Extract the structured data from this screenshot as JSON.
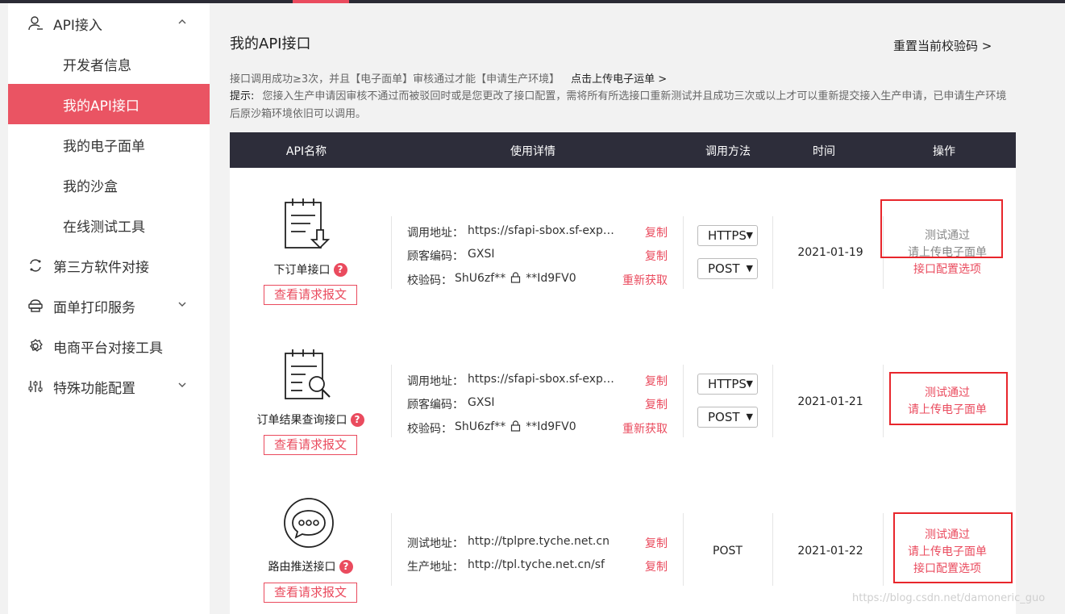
{
  "sidebar": {
    "items": [
      {
        "label": "API接入"
      },
      {
        "label": "开发者信息"
      },
      {
        "label": "我的API接口"
      },
      {
        "label": "我的电子面单"
      },
      {
        "label": "我的沙盒"
      },
      {
        "label": "在线测试工具"
      },
      {
        "label": "第三方软件对接"
      },
      {
        "label": "面单打印服务"
      },
      {
        "label": "电商平台对接工具"
      },
      {
        "label": "特殊功能配置"
      }
    ]
  },
  "main": {
    "title": "我的API接口",
    "reset_link": "重置当前校验码 >",
    "notice_line1": "接口调用成功≥3次，并且【电子面单】审核通过才能【申请生产环境】",
    "upload_link": "点击上传电子运单 >",
    "notice_label": "提示:",
    "notice_line2": "您接入生产申请因审核不通过而被驳回时或是您更改了接口配置，需将所有所选接口重新测试并且成功三次或以上才可以重新提交接入生产申请，已申请生产环境后原沙箱环境依旧可以调用。"
  },
  "table": {
    "headers": [
      "API名称",
      "使用详情",
      "调用方法",
      "时间",
      "操作"
    ],
    "rows": [
      {
        "name": "下订单接口",
        "help": "?",
        "request_btn": "查看请求报文",
        "labels": [
          "调用地址：",
          "顾客编码：",
          "校验码："
        ],
        "values": [
          "https://sfapi-sbox.sf-express.com",
          "GXSI",
          "ShU6zf**"
        ],
        "code_suffix": "**Id9FV0",
        "actions": [
          "复制",
          "复制",
          "重新获取"
        ],
        "methods": [
          "HTTPS",
          "POST"
        ],
        "date": "2021-01-19",
        "ops": [
          "测试通过",
          "请上传电子面单",
          "接口配置选项"
        ]
      },
      {
        "name": "订单结果查询接口",
        "help": "?",
        "request_btn": "查看请求报文",
        "labels": [
          "调用地址：",
          "顾客编码：",
          "校验码："
        ],
        "values": [
          "https://sfapi-sbox.sf-express.com",
          "GXSI",
          "ShU6zf**"
        ],
        "code_suffix": "**Id9FV0",
        "actions": [
          "复制",
          "复制",
          "重新获取"
        ],
        "methods": [
          "HTTPS",
          "POST"
        ],
        "date": "2021-01-21",
        "ops": [
          "测试通过",
          "请上传电子面单"
        ]
      },
      {
        "name": "路由推送接口",
        "help": "?",
        "request_btn": "查看请求报文",
        "labels": [
          "测试地址：",
          "生产地址："
        ],
        "values": [
          "http://tplpre.tyche.net.cn",
          "http://tpl.tyche.net.cn/sf"
        ],
        "actions": [
          "复制",
          "复制"
        ],
        "method": "POST",
        "date": "2021-01-22",
        "ops": [
          "测试通过",
          "请上传电子面单",
          "接口配置选项"
        ]
      }
    ]
  },
  "watermark": "https://blog.csdn.net/damoneric_guo",
  "colors": {
    "accent": "#ea4b5e",
    "header": "#2d2d3a",
    "highlight": "#e8262c"
  }
}
